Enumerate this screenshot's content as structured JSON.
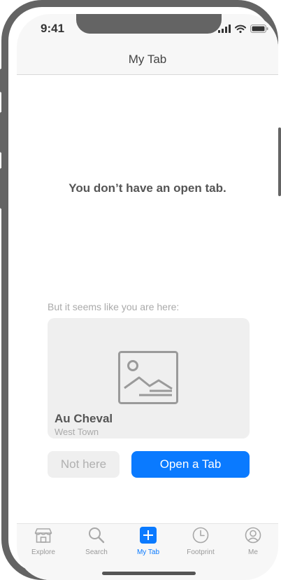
{
  "status_bar": {
    "time": "9:41"
  },
  "navbar": {
    "title": "My Tab"
  },
  "empty_state": {
    "message": "You don’t have an open tab."
  },
  "suggestion": {
    "hint": "But it seems like you are here:",
    "place_name": "Au Cheval",
    "place_area": "West Town",
    "image_icon": "image-placeholder-icon"
  },
  "actions": {
    "not_here_label": "Not here",
    "open_tab_label": "Open a Tab"
  },
  "tabbar": {
    "items": [
      {
        "label": "Explore",
        "icon": "storefront-icon",
        "active": false
      },
      {
        "label": "Search",
        "icon": "search-icon",
        "active": false
      },
      {
        "label": "My Tab",
        "icon": "plus-icon",
        "active": true
      },
      {
        "label": "Footprint",
        "icon": "clock-icon",
        "active": false
      },
      {
        "label": "Me",
        "icon": "profile-icon",
        "active": false
      }
    ]
  },
  "colors": {
    "accent": "#0a7aff",
    "frame": "#646464",
    "card_bg": "#efefef",
    "muted_text": "#aaaaaa"
  }
}
